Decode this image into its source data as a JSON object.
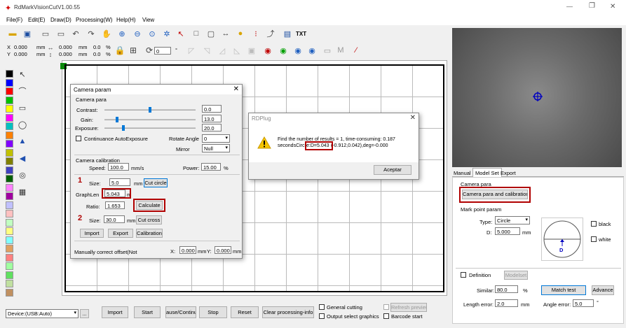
{
  "app": {
    "title": "RdMarkVisionCutV1.00.55",
    "brand_color": "#d40000",
    "accent": "#0078d7"
  },
  "window_controls": {
    "minimize": "—",
    "restore": "❐",
    "close": "✕"
  },
  "menu": [
    "File(F)",
    "Edit(E)",
    "Draw(D)",
    "Processing(W)",
    "Help(H)",
    "View"
  ],
  "toolbar1": {
    "txt_label": "TXT"
  },
  "coords": {
    "x_label": "X",
    "x_value": "0.000",
    "y_label": "Y",
    "y_value": "0.000",
    "unit": "mm",
    "w_value": "0.000",
    "h_value": "0.000",
    "pct1": "0.0",
    "pct2": "0.0",
    "pct_unit": "%",
    "angle_value": "0",
    "deg": "°"
  },
  "palette": [
    "#000000",
    "#0000ff",
    "#ff0000",
    "#00c000",
    "#ffff00",
    "#ff00ff",
    "#00c0c0",
    "#ff8000",
    "#8000ff",
    "#c0c000",
    "#808000",
    "#4040c0",
    "#006000",
    "#ff80ff",
    "#a000a0",
    "#c0c0ff",
    "#ffc0c0",
    "#c0ffc0",
    "#ffff80",
    "#80ffff",
    "#e0a060",
    "#ff8080",
    "#a0ffa0",
    "#60e060",
    "#c0e0a0",
    "#c09060"
  ],
  "camera_dialog": {
    "title": "Camera param",
    "close": "✕",
    "section1": "Camera para",
    "contrast_label": "Contrast:",
    "contrast_value": "0.0",
    "contrast_level": 0.5,
    "gain_label": "Gain:",
    "gain_value": "13.0",
    "gain_level": 0.13,
    "exposure_label": "Exposure:",
    "exposure_value": "20.0",
    "exposure_level": 0.2,
    "auto_exposure_label": "Continuance AutoExposure",
    "rotate_label": "Rotate Angle",
    "rotate_value": "0",
    "mirror_label": "Mirror",
    "mirror_value": "Null",
    "section2": "Camera calibration",
    "speed_label": "Speed:",
    "speed_value": "100.0",
    "speed_unit": "mm/s",
    "power_label": "Power:",
    "power_value": "15.00",
    "power_unit": "%",
    "step1_num": "1",
    "size1_label": "Size:",
    "size1_value": "5.0",
    "size1_unit": "mm",
    "cut_circle": "Cut circle",
    "graphlen_label": "GraphLen",
    "graphlen_value": "5.043",
    "graphlen_unit": "m",
    "ratio_label": "Ratio:",
    "ratio_value": "1.653",
    "calculate": "Calculate",
    "step2_num": "2",
    "size2_label": "Size:",
    "size2_value": "30.0",
    "size2_unit": "mm",
    "cut_cross": "Cut cross",
    "import": "Import",
    "export": "Export",
    "calibration": "Calibration",
    "manual_label": "Manually correct offset(Not",
    "offx_label": "X:",
    "offx_value": "0.000",
    "offx_unit": "mm",
    "offy_label": "Y:",
    "offy_value": "0.000",
    "offy_unit": "mm"
  },
  "rdplug": {
    "title": "RDPlug",
    "close": "✕",
    "line1": "Find the number of results = 1, time-consuming: 0.187",
    "line2_a": "secondsCirc",
    "line2_b": "e:D=5.043",
    "line2_c": "(-0.912,0.042),deg=-0.000",
    "ok": "Aceptar"
  },
  "right_panel": {
    "tabs": [
      "Manual",
      "Model Set",
      "Export"
    ],
    "camera_para_label": "Camera para",
    "camera_para_button": "Camera para and calibration",
    "mark_point_label": "Mark point param",
    "type_label": "Type:",
    "type_value": "Circle",
    "d_label": "D:",
    "d_value": "5.000",
    "d_unit": "mm",
    "circle_letter": "D",
    "black_label": "black",
    "white_label": "white",
    "definition_label": "Definition",
    "modelset_button": "Modelset",
    "similar_label": "Similar:",
    "similar_value": "80.0",
    "similar_unit": "%",
    "match_test": "Match test",
    "advance": "Advance",
    "length_label": "Length error:",
    "length_value": "2.0",
    "length_unit": "mm",
    "angle_label": "Angle error:",
    "angle_value": "5.0",
    "angle_unit": "°"
  },
  "bottom": {
    "device_value": "Device:(USB:Auto)",
    "more": "...",
    "import": "Import",
    "start": "Start",
    "pause": "ause/Continu",
    "stop": "Stop",
    "reset": "Reset",
    "clear": "Clear processing-info",
    "general_cutting": "General cutting",
    "output_selected": "Output select graphics",
    "refresh_preview": "Refresh preview",
    "barcode_start": "Barcode start"
  }
}
